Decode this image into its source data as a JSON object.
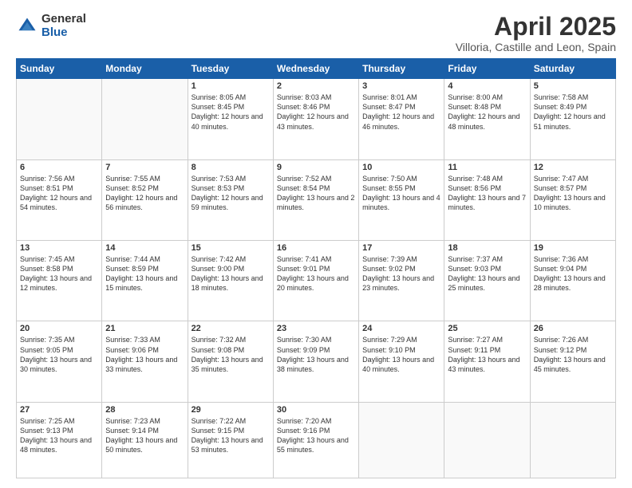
{
  "logo": {
    "general": "General",
    "blue": "Blue"
  },
  "header": {
    "title": "April 2025",
    "location": "Villoria, Castille and Leon, Spain"
  },
  "days_of_week": [
    "Sunday",
    "Monday",
    "Tuesday",
    "Wednesday",
    "Thursday",
    "Friday",
    "Saturday"
  ],
  "weeks": [
    [
      {
        "day": "",
        "info": ""
      },
      {
        "day": "",
        "info": ""
      },
      {
        "day": "1",
        "info": "Sunrise: 8:05 AM\nSunset: 8:45 PM\nDaylight: 12 hours and 40 minutes."
      },
      {
        "day": "2",
        "info": "Sunrise: 8:03 AM\nSunset: 8:46 PM\nDaylight: 12 hours and 43 minutes."
      },
      {
        "day": "3",
        "info": "Sunrise: 8:01 AM\nSunset: 8:47 PM\nDaylight: 12 hours and 46 minutes."
      },
      {
        "day": "4",
        "info": "Sunrise: 8:00 AM\nSunset: 8:48 PM\nDaylight: 12 hours and 48 minutes."
      },
      {
        "day": "5",
        "info": "Sunrise: 7:58 AM\nSunset: 8:49 PM\nDaylight: 12 hours and 51 minutes."
      }
    ],
    [
      {
        "day": "6",
        "info": "Sunrise: 7:56 AM\nSunset: 8:51 PM\nDaylight: 12 hours and 54 minutes."
      },
      {
        "day": "7",
        "info": "Sunrise: 7:55 AM\nSunset: 8:52 PM\nDaylight: 12 hours and 56 minutes."
      },
      {
        "day": "8",
        "info": "Sunrise: 7:53 AM\nSunset: 8:53 PM\nDaylight: 12 hours and 59 minutes."
      },
      {
        "day": "9",
        "info": "Sunrise: 7:52 AM\nSunset: 8:54 PM\nDaylight: 13 hours and 2 minutes."
      },
      {
        "day": "10",
        "info": "Sunrise: 7:50 AM\nSunset: 8:55 PM\nDaylight: 13 hours and 4 minutes."
      },
      {
        "day": "11",
        "info": "Sunrise: 7:48 AM\nSunset: 8:56 PM\nDaylight: 13 hours and 7 minutes."
      },
      {
        "day": "12",
        "info": "Sunrise: 7:47 AM\nSunset: 8:57 PM\nDaylight: 13 hours and 10 minutes."
      }
    ],
    [
      {
        "day": "13",
        "info": "Sunrise: 7:45 AM\nSunset: 8:58 PM\nDaylight: 13 hours and 12 minutes."
      },
      {
        "day": "14",
        "info": "Sunrise: 7:44 AM\nSunset: 8:59 PM\nDaylight: 13 hours and 15 minutes."
      },
      {
        "day": "15",
        "info": "Sunrise: 7:42 AM\nSunset: 9:00 PM\nDaylight: 13 hours and 18 minutes."
      },
      {
        "day": "16",
        "info": "Sunrise: 7:41 AM\nSunset: 9:01 PM\nDaylight: 13 hours and 20 minutes."
      },
      {
        "day": "17",
        "info": "Sunrise: 7:39 AM\nSunset: 9:02 PM\nDaylight: 13 hours and 23 minutes."
      },
      {
        "day": "18",
        "info": "Sunrise: 7:37 AM\nSunset: 9:03 PM\nDaylight: 13 hours and 25 minutes."
      },
      {
        "day": "19",
        "info": "Sunrise: 7:36 AM\nSunset: 9:04 PM\nDaylight: 13 hours and 28 minutes."
      }
    ],
    [
      {
        "day": "20",
        "info": "Sunrise: 7:35 AM\nSunset: 9:05 PM\nDaylight: 13 hours and 30 minutes."
      },
      {
        "day": "21",
        "info": "Sunrise: 7:33 AM\nSunset: 9:06 PM\nDaylight: 13 hours and 33 minutes."
      },
      {
        "day": "22",
        "info": "Sunrise: 7:32 AM\nSunset: 9:08 PM\nDaylight: 13 hours and 35 minutes."
      },
      {
        "day": "23",
        "info": "Sunrise: 7:30 AM\nSunset: 9:09 PM\nDaylight: 13 hours and 38 minutes."
      },
      {
        "day": "24",
        "info": "Sunrise: 7:29 AM\nSunset: 9:10 PM\nDaylight: 13 hours and 40 minutes."
      },
      {
        "day": "25",
        "info": "Sunrise: 7:27 AM\nSunset: 9:11 PM\nDaylight: 13 hours and 43 minutes."
      },
      {
        "day": "26",
        "info": "Sunrise: 7:26 AM\nSunset: 9:12 PM\nDaylight: 13 hours and 45 minutes."
      }
    ],
    [
      {
        "day": "27",
        "info": "Sunrise: 7:25 AM\nSunset: 9:13 PM\nDaylight: 13 hours and 48 minutes."
      },
      {
        "day": "28",
        "info": "Sunrise: 7:23 AM\nSunset: 9:14 PM\nDaylight: 13 hours and 50 minutes."
      },
      {
        "day": "29",
        "info": "Sunrise: 7:22 AM\nSunset: 9:15 PM\nDaylight: 13 hours and 53 minutes."
      },
      {
        "day": "30",
        "info": "Sunrise: 7:20 AM\nSunset: 9:16 PM\nDaylight: 13 hours and 55 minutes."
      },
      {
        "day": "",
        "info": ""
      },
      {
        "day": "",
        "info": ""
      },
      {
        "day": "",
        "info": ""
      }
    ]
  ]
}
